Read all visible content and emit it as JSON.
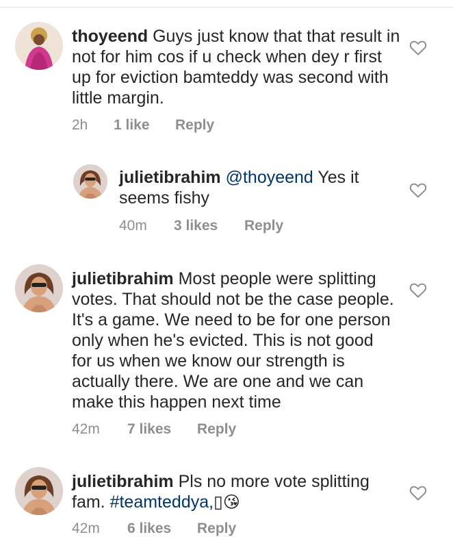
{
  "comments": [
    {
      "username": "thoyeend",
      "text": "Guys just know that that result in not for him cos if u check when dey r first up for eviction bamteddy was second with little margin.",
      "time": "2h",
      "likes": "1 like",
      "reply": "Reply",
      "avatar_icon": "profile-photo-woman-pink-dress"
    },
    {
      "username": "julietibrahim",
      "mention": "@thoyeend",
      "text": "Yes it seems fishy",
      "time": "40m",
      "likes": "3 likes",
      "reply": "Reply",
      "avatar_icon": "profile-photo-woman-sunglasses"
    },
    {
      "username": "julietibrahim",
      "text": "Most people were splitting votes. That should not be the case people. It's a game. We need to be for one person only when he's evicted. This is not good for us when we know our strength is actually there. We are one and we can make this happen next time",
      "time": "42m",
      "likes": "7 likes",
      "reply": "Reply",
      "avatar_icon": "profile-photo-woman-sunglasses"
    },
    {
      "username": "julietibrahim",
      "text": "Pls no more vote splitting fam.",
      "hashtag": "#teamteddya,",
      "emoji_missing": "▯",
      "emoji": "😘",
      "time": "42m",
      "likes": "6 likes",
      "reply": "Reply",
      "avatar_icon": "profile-photo-woman-sunglasses"
    }
  ],
  "colors": {
    "text": "#262626",
    "meta": "#8e8e8e",
    "link": "#003569",
    "divider": "#e6e6e6"
  }
}
